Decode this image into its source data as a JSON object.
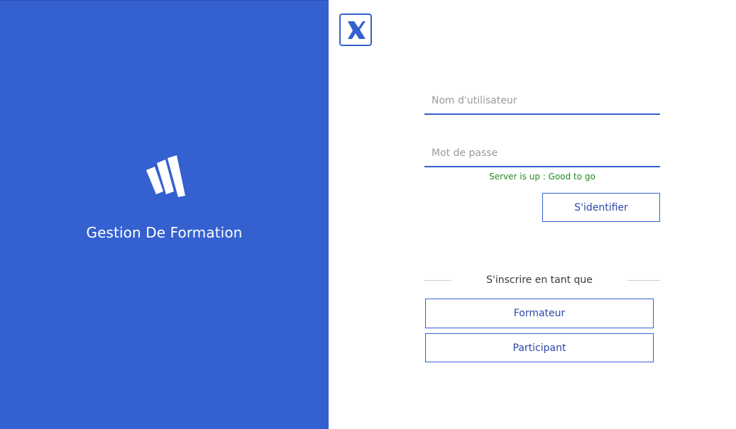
{
  "left_panel": {
    "title": "Gestion De Formation",
    "background": "#3460d0",
    "logo_icon": "brand-stripes-logo-icon"
  },
  "corner_logo": {
    "icon": "x-letter-logo-icon"
  },
  "login": {
    "username_placeholder": "Nom d'utilisateur",
    "username_value": "",
    "password_placeholder": "Mot de passe",
    "password_value": "",
    "status": "Server is up : Good to go",
    "status_color": "#1f8a1f",
    "submit_label": "S'identifier"
  },
  "signup": {
    "divider_label": "S'inscrire en tant que",
    "trainer_label": "Formateur",
    "participant_label": "Participant"
  },
  "colors": {
    "accent": "#3460d0",
    "button_text": "#2a47a8"
  }
}
